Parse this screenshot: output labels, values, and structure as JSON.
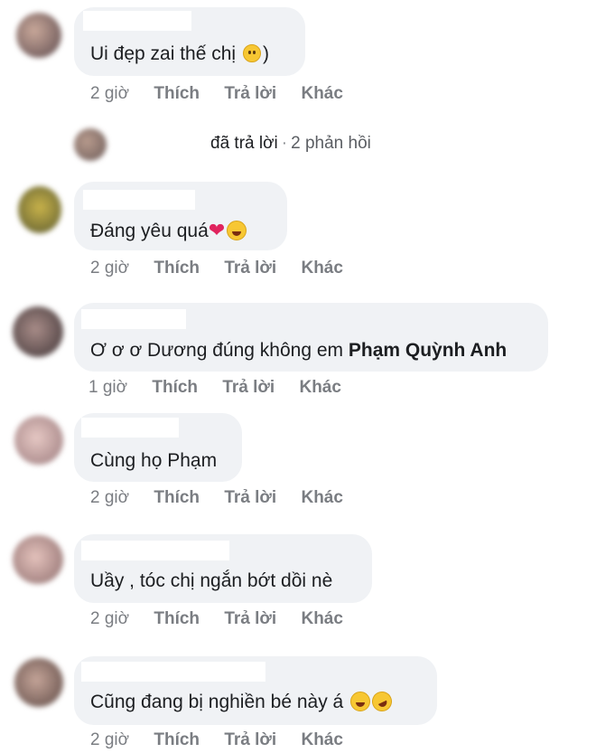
{
  "comments": [
    {
      "text": "Ui đẹp zai thế chị",
      "emoji": "smile",
      "suffix": ")",
      "time": "2 giờ"
    },
    {
      "text": "Đáng yêu quá",
      "emoji": "heart-hug",
      "time": "2 giờ"
    },
    {
      "text": "Ơ ơ ơ Dương đúng không em ",
      "mention": "Phạm Quỳnh Anh",
      "time": "1 giờ"
    },
    {
      "text": "Cùng họ Phạm",
      "time": "2 giờ"
    },
    {
      "text": "Uầy , tóc chị ngắn bớt dồi nè",
      "time": "2 giờ"
    },
    {
      "text": "Cũng đang bị nghiền bé này á",
      "emoji": "laugh",
      "time": "2 giờ"
    }
  ],
  "actions": {
    "like": "Thích",
    "reply": "Trả lời",
    "more": "Khác"
  },
  "reply_summary": {
    "replied": "đã trả lời",
    "separator": "·",
    "count_text": "2 phản hồi"
  },
  "colors": {
    "bubble": "#f0f2f5",
    "meta": "#7a7d82",
    "text": "#1c1e21"
  }
}
